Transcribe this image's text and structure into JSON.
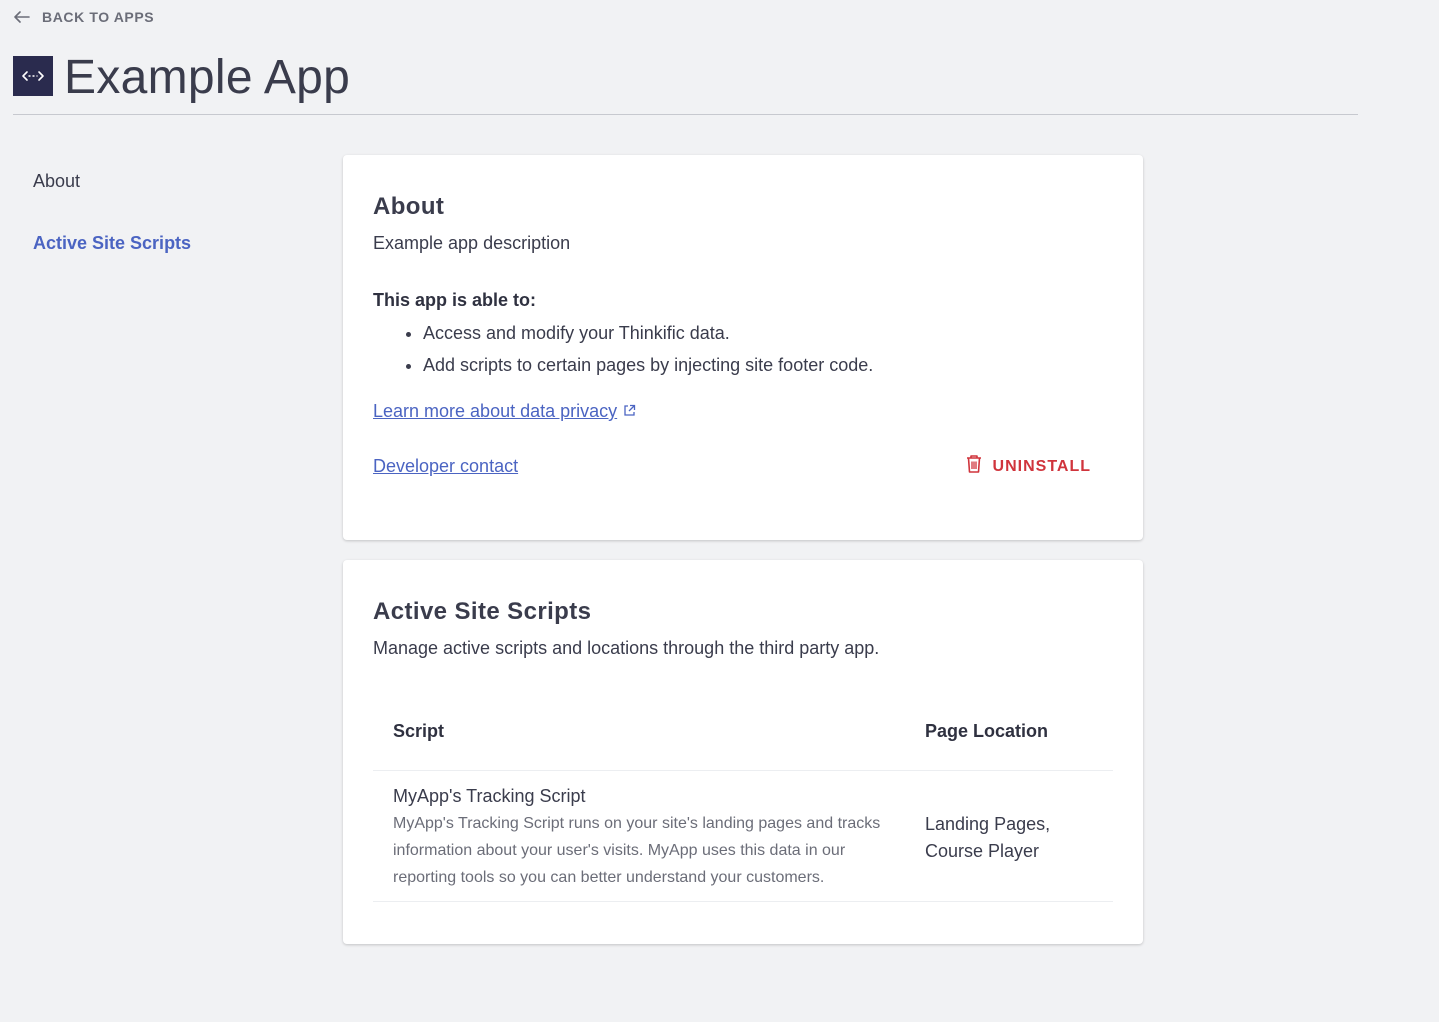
{
  "nav": {
    "back_label": "BACK TO APPS"
  },
  "app": {
    "title": "Example App",
    "logo_icon": "code-arrows-icon"
  },
  "sidebar": {
    "items": [
      {
        "label": "About",
        "active": false
      },
      {
        "label": "Active Site Scripts",
        "active": true
      }
    ]
  },
  "about": {
    "title": "About",
    "description": "Example app description",
    "capabilities_heading": "This app is able to:",
    "capabilities": [
      "Access and modify your Thinkific data.",
      "Add scripts to certain pages by injecting site footer code."
    ],
    "privacy_link": "Learn more about data privacy",
    "developer_contact": "Developer contact",
    "uninstall_label": "UNINSTALL"
  },
  "scripts": {
    "title": "Active Site Scripts",
    "description": "Manage active scripts and locations through the third party app.",
    "columns": [
      "Script",
      "Page Location"
    ],
    "rows": [
      {
        "name": "MyApp's Tracking Script",
        "description": "MyApp's Tracking Script runs on your site's landing pages and tracks information about your user's visits. MyApp uses this data in our reporting tools so you can better understand your customers.",
        "location_line1": "Landing Pages,",
        "location_line2": "Course Player"
      }
    ]
  },
  "colors": {
    "background": "#f1f2f4",
    "accent": "#4b64c2",
    "danger": "#d0343c",
    "logo_bg": "#2a2b4e"
  }
}
